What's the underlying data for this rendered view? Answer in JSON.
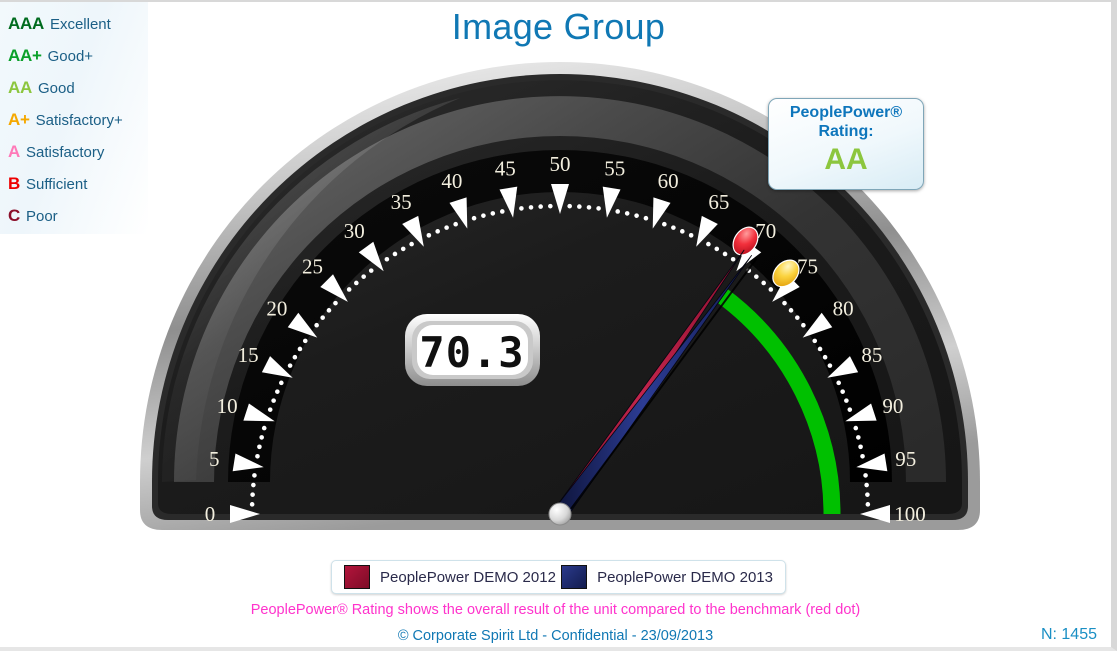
{
  "header": {
    "title": "Image Group"
  },
  "rating_legend": [
    {
      "code": "AAA",
      "label": "Excellent",
      "color": "#006b1e"
    },
    {
      "code": "AA+",
      "label": "Good+",
      "color": "#0aa02a"
    },
    {
      "code": "AA",
      "label": "Good",
      "color": "#8cc63e"
    },
    {
      "code": "A+",
      "label": "Satisfactory+",
      "color": "#f5a800"
    },
    {
      "code": "A",
      "label": "Satisfactory",
      "color": "#ff79b8"
    },
    {
      "code": "B",
      "label": "Sufficient",
      "color": "#ee0000"
    },
    {
      "code": "C",
      "label": "Poor",
      "color": "#8b0f2a"
    }
  ],
  "callout": {
    "line1": "PeoplePower®",
    "line2": "Rating:",
    "value": "AA",
    "value_color": "#8cc63e",
    "text_color": "#0e76bc"
  },
  "gauge": {
    "min": 0,
    "max": 100,
    "major_ticks": [
      0,
      5,
      10,
      15,
      20,
      25,
      30,
      35,
      40,
      45,
      50,
      55,
      60,
      65,
      70,
      75,
      80,
      85,
      90,
      95,
      100
    ],
    "minor_tick_step": 1,
    "digital_display": "70.3",
    "band": {
      "from": 70.3,
      "to": 100,
      "color": "#00c000",
      "label": "good-zone"
    },
    "markers": [
      {
        "name": "benchmark-red-dot",
        "value": 69.0,
        "color": "#ef2d3a"
      },
      {
        "name": "target-yellow-dot",
        "value": 74.0,
        "color": "#f7cf34"
      }
    ],
    "needles": [
      {
        "name": "PeoplePower DEMO 2012",
        "value": 70.0,
        "color": "#b3153c"
      },
      {
        "name": "PeoplePower DEMO 2013",
        "value": 70.3,
        "color": "#1b2a78"
      }
    ],
    "face_color": "#1f1f1f",
    "bezel_color": "#b8b8b8",
    "tick_label_color": "#f2eede"
  },
  "series_legend": [
    {
      "label": "PeoplePower DEMO 2012",
      "color": "#b3153c"
    },
    {
      "label": "PeoplePower DEMO 2013",
      "color": "#121c4e"
    }
  ],
  "footer": {
    "note": "PeoplePower® Rating shows the overall result of the unit compared to the benchmark (red dot)",
    "copyright": "© Corporate Spirit Ltd - Confidential - 23/09/2013",
    "n_label": "N: 1455"
  }
}
